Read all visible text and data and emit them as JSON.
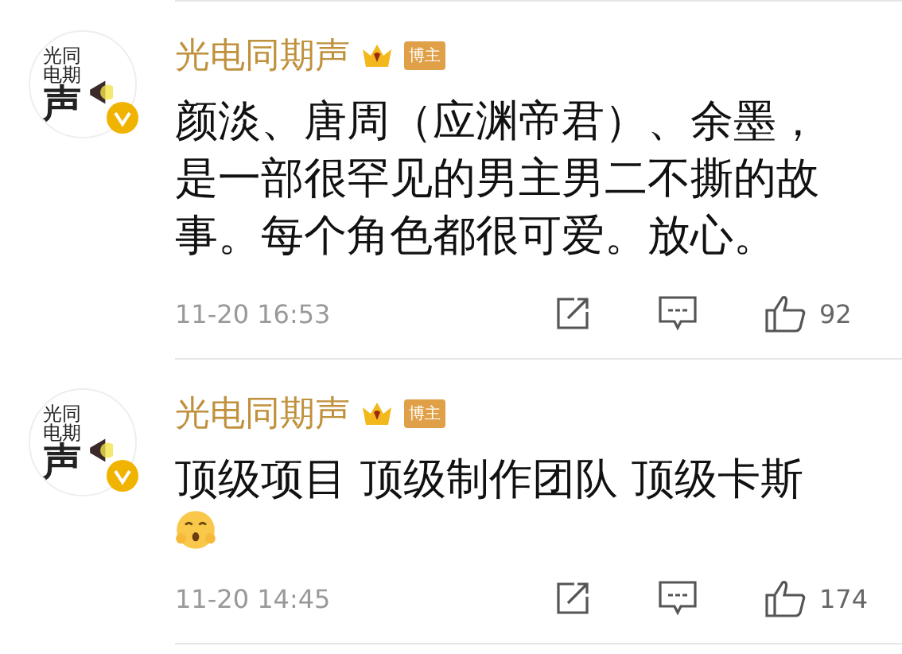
{
  "comments": [
    {
      "avatar_lines": [
        "光同",
        "电期",
        "声"
      ],
      "verified": true,
      "author": "光电同期声",
      "crown": true,
      "badge": "博主",
      "text": "颜淡、唐周（应渊帝君）、余墨，是一部很罕见的男主男二不撕的故事。每个角色都很可爱。放心。",
      "time": "11-20 16:53",
      "likes": "92"
    },
    {
      "avatar_lines": [
        "光同",
        "电期",
        "声"
      ],
      "verified": true,
      "author": "光电同期声",
      "crown": true,
      "badge": "博主",
      "text": "顶级项目 顶级制作团队 顶级卡斯",
      "emoji": true,
      "time": "11-20 14:45",
      "likes": "174"
    }
  ]
}
